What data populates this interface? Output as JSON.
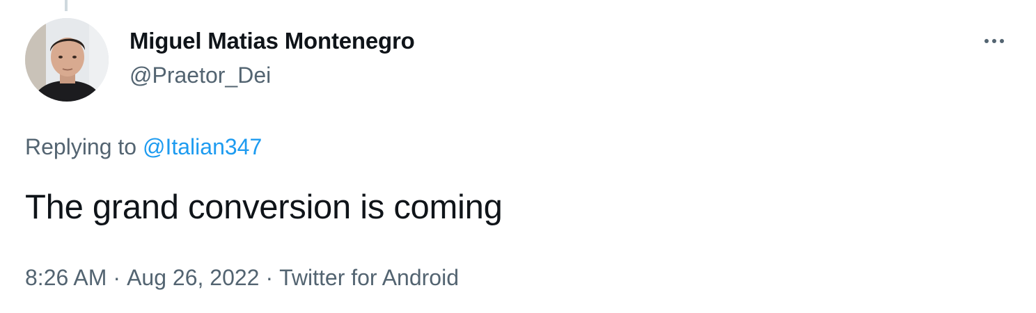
{
  "tweet": {
    "author": {
      "display_name": "Miguel Matias Montenegro",
      "handle": "@Praetor_Dei",
      "avatar_icon": "profile-photo"
    },
    "replying_to": {
      "prefix": "Replying to",
      "mention": "@Italian347"
    },
    "text": "The grand conversion is coming",
    "time": "8:26 AM",
    "separator": "·",
    "date": "Aug 26, 2022",
    "source": "Twitter for Android",
    "more_icon": "more-horizontal-icon"
  },
  "colors": {
    "text_primary": "#0f1419",
    "text_secondary": "#536471",
    "link": "#1d9bf0",
    "thread_line": "#cfd9de",
    "background": "#ffffff"
  }
}
